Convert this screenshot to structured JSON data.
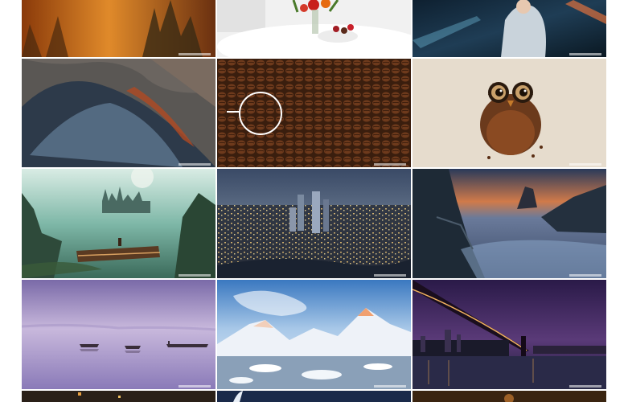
{
  "gallery": {
    "tiles": [
      {
        "subject": "misty-pine-forest-sunset"
      },
      {
        "subject": "flowers-and-strawberries-on-white-table"
      },
      {
        "subject": "sci-fi-girl-in-armor"
      },
      {
        "subject": "aerial-mountain-ridge"
      },
      {
        "subject": "coffee-beans-with-circle"
      },
      {
        "subject": "coffee-bean-owl"
      },
      {
        "subject": "fantasy-castle-and-airship"
      },
      {
        "subject": "city-skyline-at-dusk"
      },
      {
        "subject": "rocky-coast-long-exposure"
      },
      {
        "subject": "boats-on-misty-purple-lake"
      },
      {
        "subject": "snowy-mountains-at-sunset"
      },
      {
        "subject": "bridge-over-river-at-night"
      }
    ]
  },
  "colors": {
    "background": "#ffffff"
  }
}
